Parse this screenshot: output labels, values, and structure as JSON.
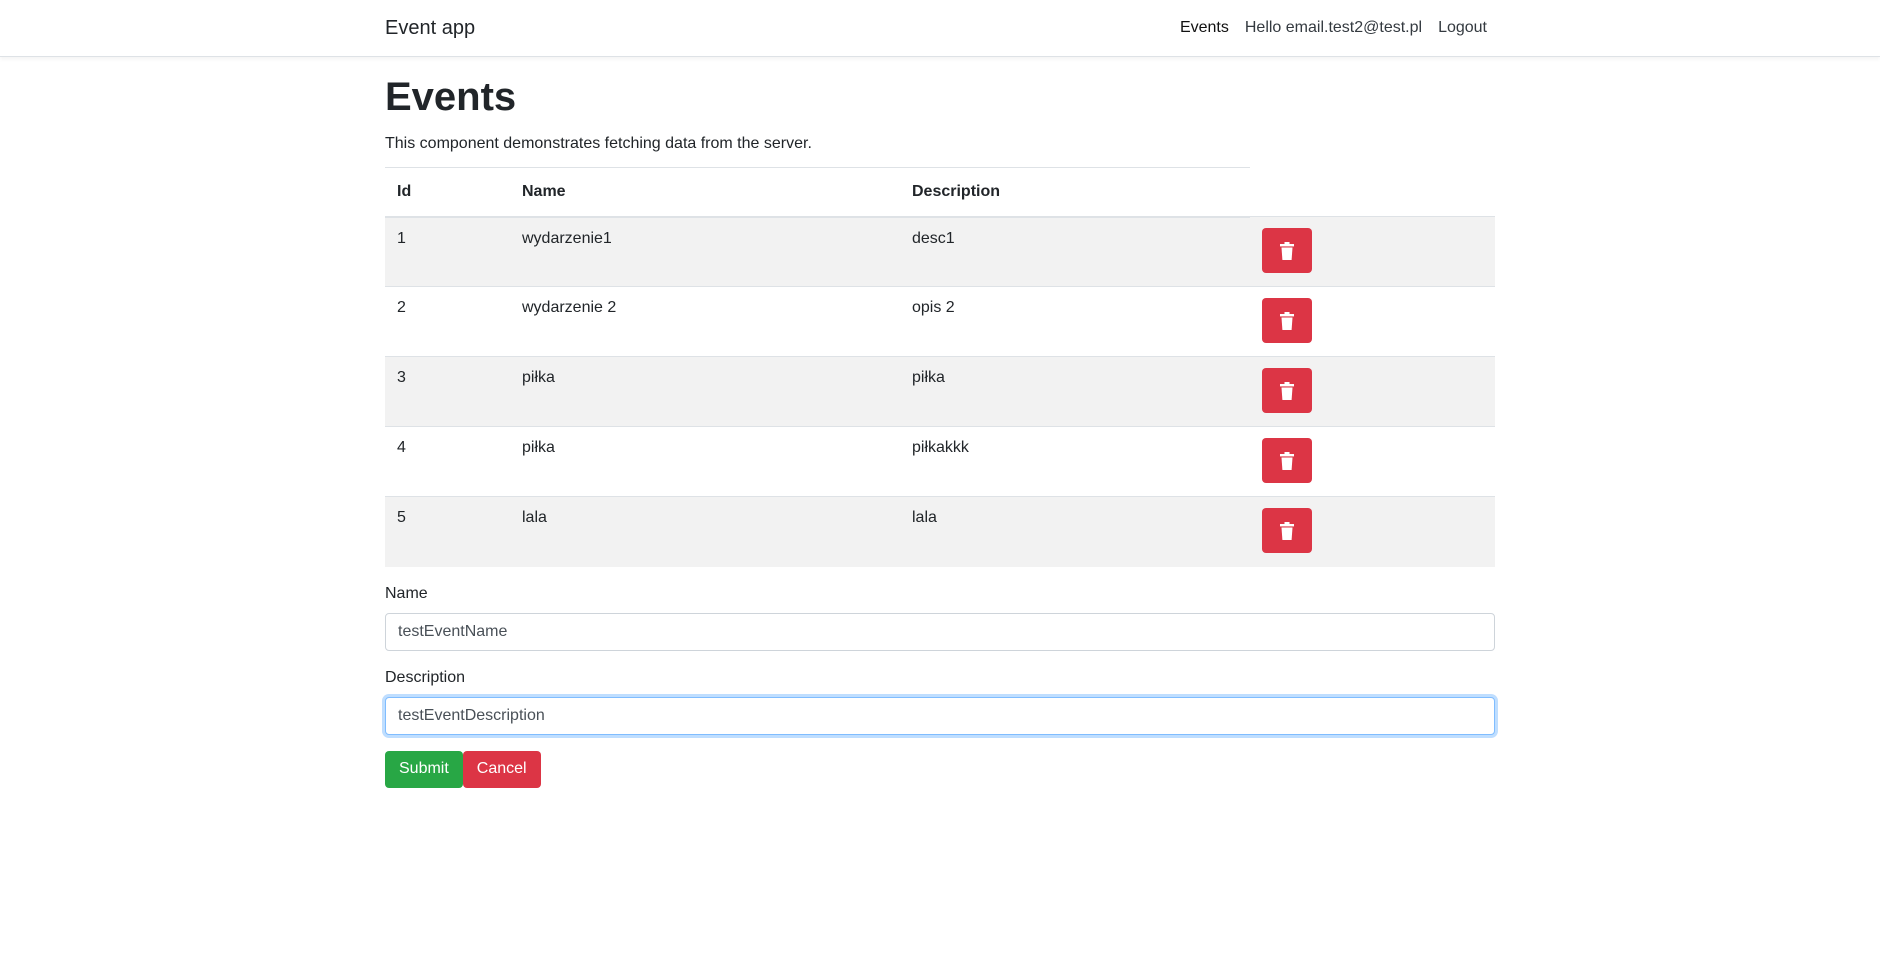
{
  "navbar": {
    "brand": "Event app",
    "links": {
      "events": "Events",
      "hello": "Hello email.test2@test.pl",
      "logout": "Logout"
    }
  },
  "page": {
    "title": "Events",
    "subtitle": "This component demonstrates fetching data from the server."
  },
  "table": {
    "headers": {
      "id": "Id",
      "name": "Name",
      "description": "Description"
    },
    "rows": [
      {
        "id": "1",
        "name": "wydarzenie1",
        "description": "desc1"
      },
      {
        "id": "2",
        "name": "wydarzenie 2",
        "description": "opis 2"
      },
      {
        "id": "3",
        "name": "piłka",
        "description": "piłka"
      },
      {
        "id": "4",
        "name": "piłka",
        "description": "piłkakkk"
      },
      {
        "id": "5",
        "name": "lala",
        "description": "lala"
      }
    ],
    "delete_icon": "trash-icon"
  },
  "form": {
    "name_label": "Name",
    "name_value": "testEventName",
    "description_label": "Description",
    "description_value": "testEventDescription",
    "submit_label": "Submit",
    "cancel_label": "Cancel"
  },
  "colors": {
    "danger": "#dc3545",
    "success": "#28a745",
    "stripe": "#f2f2f2",
    "focus": "#80bdff"
  }
}
